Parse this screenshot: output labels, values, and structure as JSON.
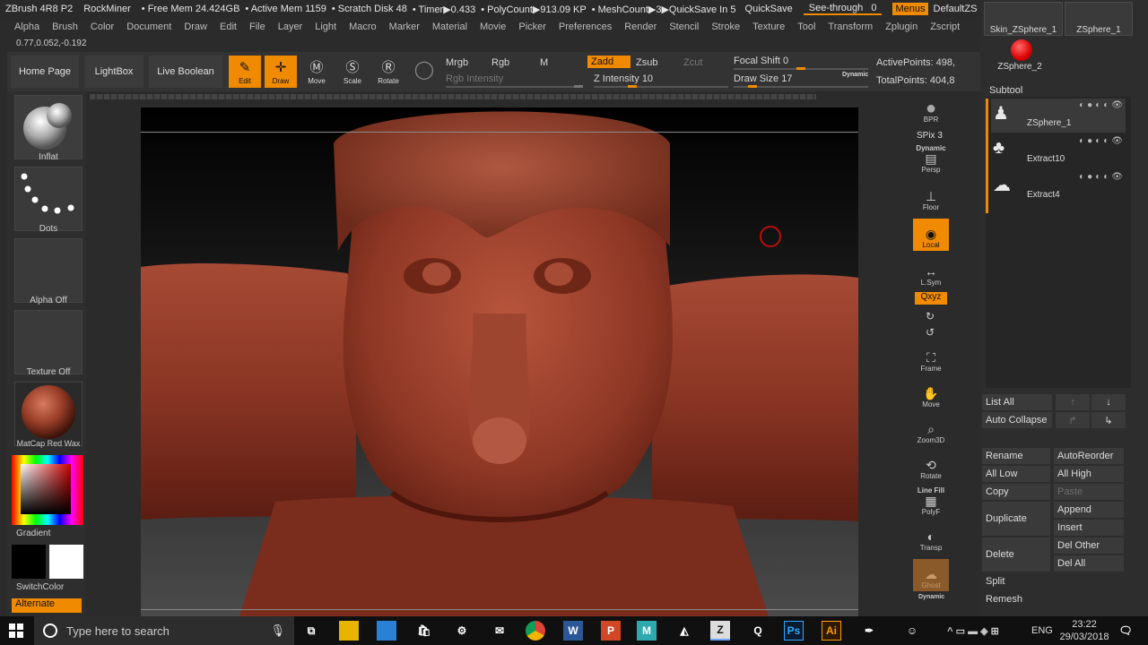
{
  "titlebar": {
    "app": "ZBrush 4R8 P2",
    "user": "RockMiner",
    "free_mem": "• Free Mem 24.424GB",
    "active_mem": "• Active Mem 1159",
    "scratch": "• Scratch Disk 48",
    "timer": "• Timer▶0.433",
    "polycount": "• PolyCount▶913.09 KP",
    "meshcount": "• MeshCount▶3",
    "quicksave_in": "▶QuickSave In 5",
    "quicksave": "QuickSave",
    "see_through_label": "See-through",
    "see_through_value": "0",
    "menus": "Menus",
    "script": "DefaultZScript"
  },
  "menu": [
    "Alpha",
    "Brush",
    "Color",
    "Document",
    "Draw",
    "Edit",
    "File",
    "Layer",
    "Light",
    "Macro",
    "Marker",
    "Material",
    "Movie",
    "Picker",
    "Preferences",
    "Render",
    "Stencil",
    "Stroke",
    "Texture",
    "Tool",
    "Transform",
    "Zplugin",
    "Zscript"
  ],
  "coords": "0.77,0.052,-0.192",
  "shelf": {
    "home": "Home Page",
    "lightbox": "LightBox",
    "liveboolean": "Live Boolean",
    "edit": "Edit",
    "draw": "Draw",
    "move": "Move",
    "scale": "Scale",
    "rotate": "Rotate",
    "mrgb": "Mrgb",
    "rgb": "Rgb",
    "m": "M",
    "zadd": "Zadd",
    "zsub": "Zsub",
    "zcut": "Zcut",
    "rgb_intensity": "Rgb Intensity",
    "z_intensity_label": "Z Intensity",
    "z_intensity_value": "10",
    "focal_shift_label": "Focal Shift",
    "focal_shift_value": "0",
    "draw_size_label": "Draw Size",
    "draw_size_value": "17",
    "dynamic": "Dynamic",
    "active_points": "ActivePoints: 498,",
    "total_points": "TotalPoints: 404,8"
  },
  "left": {
    "brush": "Inflat",
    "stroke": "Dots",
    "alpha": "Alpha Off",
    "texture": "Texture Off",
    "material": "MatCap Red Wax",
    "gradient": "Gradient",
    "switchcolor": "SwitchColor",
    "alternate": "Alternate"
  },
  "right_tools": {
    "bpr": "BPR",
    "spix": "SPix 3",
    "persp": "Persp",
    "dynamic": "Dynamic",
    "floor": "Floor",
    "local": "Local",
    "lsym": "L.Sym",
    "xyz": "Qxyz",
    "frame": "Frame",
    "move": "Move",
    "zoom3d": "Zoom3D",
    "rotate": "Rotate",
    "linefill": "Line Fill",
    "polyf": "PolyF",
    "transp": "Transp",
    "ghost": "Ghost",
    "dynamic2": "Dynamic"
  },
  "tool_thumbs": {
    "skin": "Skin_ZSphere_1",
    "zsphere1": "ZSphere_1",
    "zsphere2": "ZSphere_2"
  },
  "subtool": {
    "title": "Subtool",
    "items": [
      "ZSphere_1",
      "Extract10",
      "Extract4"
    ]
  },
  "subtool_buttons": {
    "list_all": "List All",
    "auto_collapse": "Auto Collapse",
    "rename": "Rename",
    "autoreorder": "AutoReorder",
    "all_low": "All Low",
    "all_high": "All High",
    "copy": "Copy",
    "paste": "Paste",
    "duplicate": "Duplicate",
    "append": "Append",
    "insert": "Insert",
    "delete": "Delete",
    "del_other": "Del Other",
    "del_all": "Del All",
    "split": "Split",
    "remesh": "Remesh"
  },
  "taskbar": {
    "search_placeholder": "Type here to search",
    "language": "ENG",
    "time": "23:22",
    "date": "29/03/2018"
  }
}
